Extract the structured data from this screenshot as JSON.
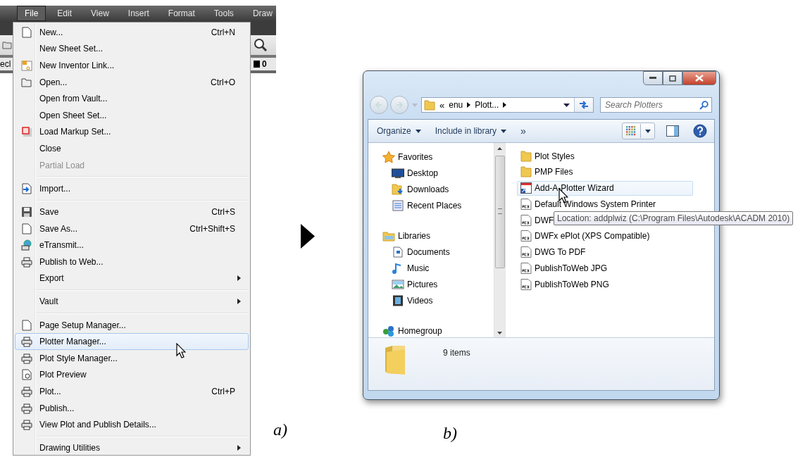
{
  "panel_a": {
    "menubar": [
      {
        "label": "File",
        "selected": true
      },
      {
        "label": "Edit",
        "selected": false
      },
      {
        "label": "View",
        "selected": false
      },
      {
        "label": "Insert",
        "selected": false
      },
      {
        "label": "Format",
        "selected": false
      },
      {
        "label": "Tools",
        "selected": false
      },
      {
        "label": "Draw",
        "selected": false
      }
    ],
    "toolbar_left_text": "ecl",
    "toolbar_right_text": "0",
    "menu": [
      {
        "kind": "item",
        "label": "New...",
        "shortcut": "Ctrl+N",
        "submenu": false,
        "disabled": false,
        "selected": false
      },
      {
        "kind": "item",
        "label": "New Sheet Set...",
        "submenu": false,
        "disabled": false,
        "selected": false
      },
      {
        "kind": "item",
        "label": "New Inventor Link...",
        "submenu": false,
        "disabled": false,
        "selected": false
      },
      {
        "kind": "item",
        "label": "Open...",
        "shortcut": "Ctrl+O",
        "submenu": false,
        "disabled": false,
        "selected": false
      },
      {
        "kind": "item",
        "label": "Open from Vault...",
        "submenu": false,
        "disabled": false,
        "selected": false
      },
      {
        "kind": "item",
        "label": "Open Sheet Set...",
        "submenu": false,
        "disabled": false,
        "selected": false
      },
      {
        "kind": "item",
        "label": "Load Markup Set...",
        "submenu": false,
        "disabled": false,
        "selected": false
      },
      {
        "kind": "item",
        "label": "Close",
        "submenu": false,
        "disabled": false,
        "selected": false
      },
      {
        "kind": "item",
        "label": "Partial Load",
        "submenu": false,
        "disabled": true,
        "selected": false
      },
      {
        "kind": "separator"
      },
      {
        "kind": "item",
        "label": "Import...",
        "submenu": false,
        "disabled": false,
        "selected": false
      },
      {
        "kind": "separator"
      },
      {
        "kind": "item",
        "label": "Save",
        "shortcut": "Ctrl+S",
        "submenu": false,
        "disabled": false,
        "selected": false
      },
      {
        "kind": "item",
        "label": "Save As...",
        "shortcut": "Ctrl+Shift+S",
        "submenu": false,
        "disabled": false,
        "selected": false
      },
      {
        "kind": "item",
        "label": "eTransmit...",
        "submenu": false,
        "disabled": false,
        "selected": false
      },
      {
        "kind": "item",
        "label": "Publish to Web...",
        "submenu": false,
        "disabled": false,
        "selected": false
      },
      {
        "kind": "item",
        "label": "Export",
        "submenu": true,
        "disabled": false,
        "selected": false
      },
      {
        "kind": "separator"
      },
      {
        "kind": "item",
        "label": "Vault",
        "submenu": true,
        "disabled": false,
        "selected": false
      },
      {
        "kind": "separator"
      },
      {
        "kind": "item",
        "label": "Page Setup Manager...",
        "submenu": false,
        "disabled": false,
        "selected": false
      },
      {
        "kind": "item",
        "label": "Plotter Manager...",
        "submenu": false,
        "disabled": false,
        "selected": true
      },
      {
        "kind": "item",
        "label": "Plot Style Manager...",
        "submenu": false,
        "disabled": false,
        "selected": false
      },
      {
        "kind": "item",
        "label": "Plot Preview",
        "submenu": false,
        "disabled": false,
        "selected": false
      },
      {
        "kind": "item",
        "label": "Plot...",
        "shortcut": "Ctrl+P",
        "submenu": false,
        "disabled": false,
        "selected": false
      },
      {
        "kind": "item",
        "label": "Publish...",
        "submenu": false,
        "disabled": false,
        "selected": false
      },
      {
        "kind": "item",
        "label": "View Plot and Publish Details...",
        "submenu": false,
        "disabled": false,
        "selected": false
      },
      {
        "kind": "separator"
      },
      {
        "kind": "item",
        "label": "Drawing Utilities",
        "submenu": true,
        "disabled": false,
        "selected": false
      }
    ],
    "caption": "a)"
  },
  "panel_b": {
    "address": {
      "overflow": "«",
      "crumbs": [
        "enu",
        "Plott..."
      ]
    },
    "search": {
      "placeholder": "Search Plotters"
    },
    "toolbar": [
      {
        "label": "Organize"
      },
      {
        "label": "Include in library"
      }
    ],
    "toolbar_more": "»",
    "navigation": [
      {
        "label": "Favorites",
        "children": [
          {
            "label": "Desktop"
          },
          {
            "label": "Downloads"
          },
          {
            "label": "Recent Places"
          }
        ]
      },
      {
        "label": "Libraries",
        "children": [
          {
            "label": "Documents"
          },
          {
            "label": "Music"
          },
          {
            "label": "Pictures"
          },
          {
            "label": "Videos"
          }
        ]
      },
      {
        "label": "Homegroup"
      }
    ],
    "files": [
      {
        "kind": "folder",
        "name": "Plot Styles",
        "selected": false
      },
      {
        "kind": "folder",
        "name": "PMP Files",
        "selected": false
      },
      {
        "kind": "shortcut",
        "name": "Add-A-Plotter Wizard",
        "selected": true
      },
      {
        "kind": "pc3",
        "name": "Default Windows System Printer",
        "selected": false
      },
      {
        "kind": "pc3",
        "name": "DWF",
        "selected": false
      },
      {
        "kind": "pc3",
        "name": "DWFx ePlot (XPS Compatible)",
        "selected": false
      },
      {
        "kind": "pc3",
        "name": "DWG To PDF",
        "selected": false
      },
      {
        "kind": "pc3",
        "name": "PublishToWeb JPG",
        "selected": false
      },
      {
        "kind": "pc3",
        "name": "PublishToWeb PNG",
        "selected": false
      }
    ],
    "tooltip": "Location: addplwiz (C:\\Program Files\\Autodesk\\ACADM 2010)",
    "status": "9 items",
    "caption": "b)"
  }
}
